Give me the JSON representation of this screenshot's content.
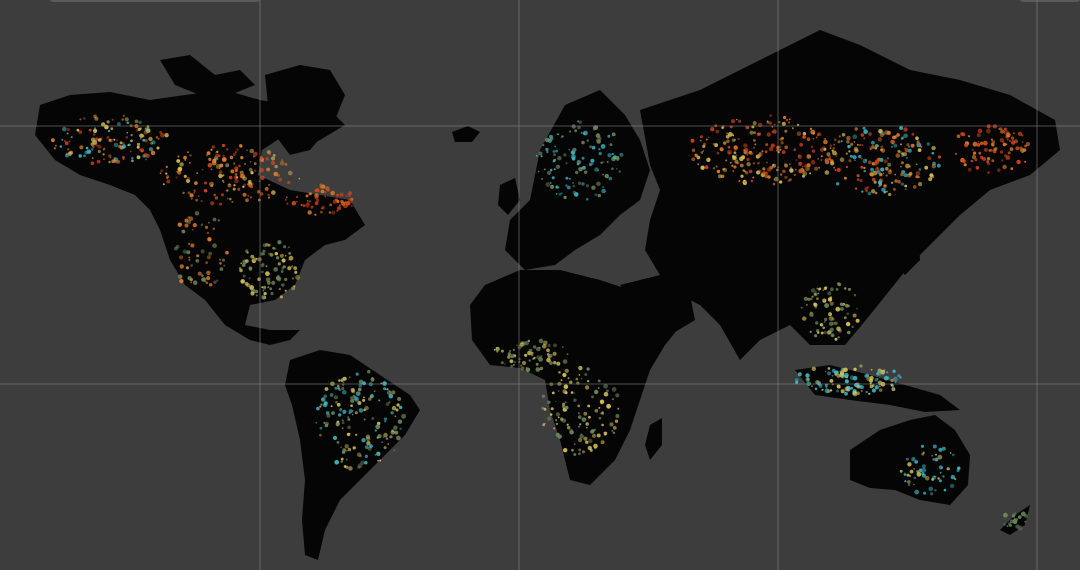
{
  "map": {
    "background_color": "#3d3d3d",
    "land_color": "#050505",
    "tile_grid": true,
    "palette": {
      "loss_recent": "#d9461a",
      "loss_mid": "#e0802a",
      "loss_old": "#d9c45a",
      "gain": "#3fb8c8",
      "tree_cover": "#6f8a5e"
    }
  }
}
